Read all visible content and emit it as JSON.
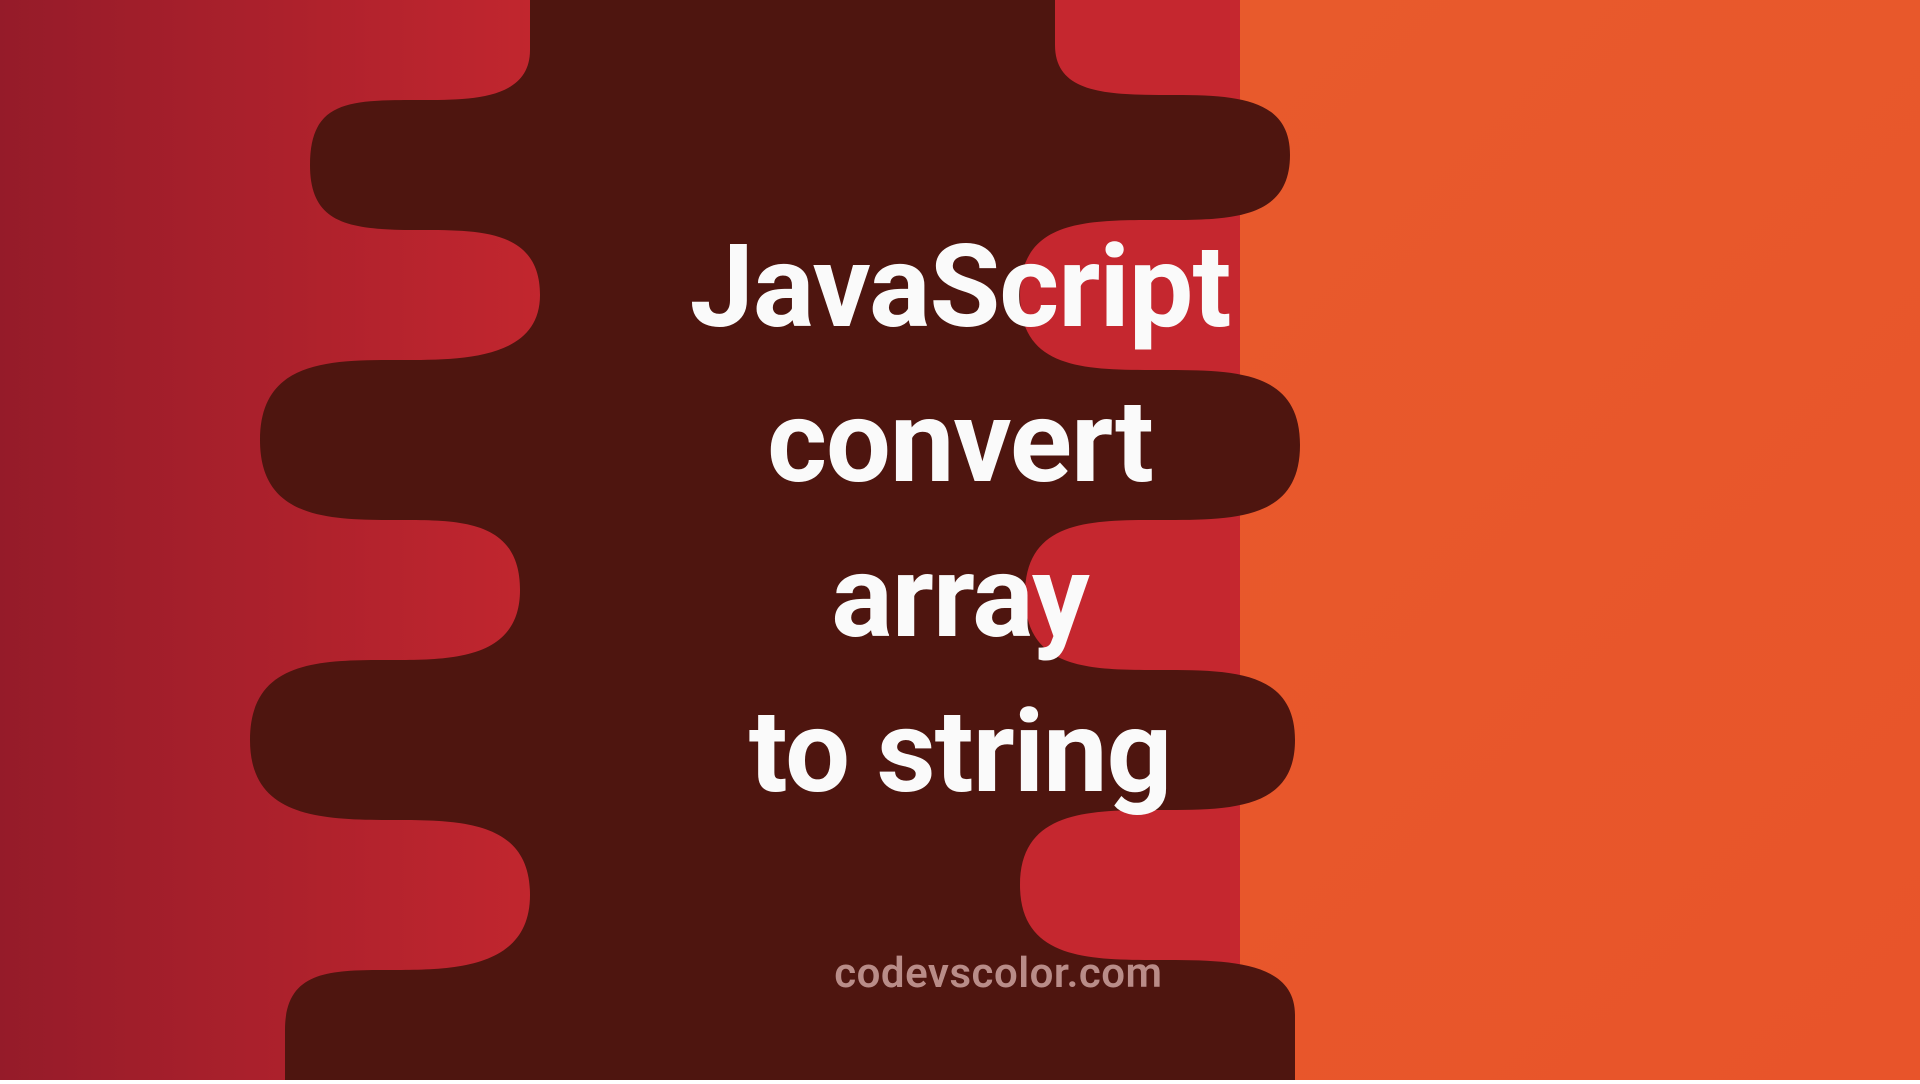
{
  "title": "JavaScript\nconvert\narray\nto string",
  "caption": "codevscolor.com",
  "colors": {
    "left_bg_start": "#951b29",
    "left_bg_end": "#c5272f",
    "right_bg": "#e8542a",
    "blob_bg": "#4e150f",
    "title_color": "#fafafa",
    "caption_color": "#b98c88"
  }
}
